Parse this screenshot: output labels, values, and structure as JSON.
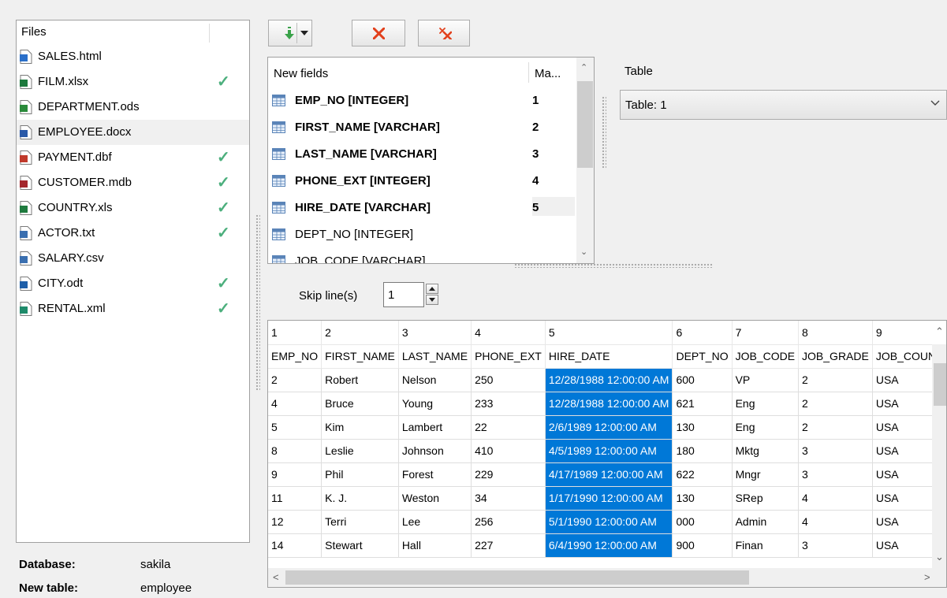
{
  "files": {
    "header": "Files",
    "items": [
      {
        "name": "SALES.html",
        "icon": "html-file-icon",
        "checked": false,
        "selected": false
      },
      {
        "name": "FILM.xlsx",
        "icon": "excel-file-icon",
        "checked": true,
        "selected": false
      },
      {
        "name": "DEPARTMENT.ods",
        "icon": "ods-file-icon",
        "checked": false,
        "selected": false
      },
      {
        "name": "EMPLOYEE.docx",
        "icon": "word-file-icon",
        "checked": false,
        "selected": true
      },
      {
        "name": "PAYMENT.dbf",
        "icon": "dbf-file-icon",
        "checked": true,
        "selected": false
      },
      {
        "name": "CUSTOMER.mdb",
        "icon": "access-file-icon",
        "checked": true,
        "selected": false
      },
      {
        "name": "COUNTRY.xls",
        "icon": "excel-file-icon",
        "checked": true,
        "selected": false
      },
      {
        "name": "ACTOR.txt",
        "icon": "txt-file-icon",
        "checked": true,
        "selected": false
      },
      {
        "name": "SALARY.csv",
        "icon": "csv-file-icon",
        "checked": false,
        "selected": false
      },
      {
        "name": "CITY.odt",
        "icon": "odt-file-icon",
        "checked": true,
        "selected": false
      },
      {
        "name": "RENTAL.xml",
        "icon": "xml-file-icon",
        "checked": true,
        "selected": false
      }
    ],
    "check_glyph": "✓"
  },
  "footer": {
    "database_label": "Database:",
    "database_value": "sakila",
    "new_table_label": "New table:",
    "new_table_value": "employee"
  },
  "toolbar": {
    "buttons": [
      "import-button",
      "import-dropdown",
      "delete-button",
      "clear-button"
    ]
  },
  "fields": {
    "header_name": "New fields",
    "header_map": "Ma...",
    "items": [
      {
        "name": "EMP_NO  [INTEGER]",
        "map": "1",
        "mapped": true,
        "highlight": false
      },
      {
        "name": "FIRST_NAME  [VARCHAR]",
        "map": "2",
        "mapped": true,
        "highlight": false
      },
      {
        "name": "LAST_NAME  [VARCHAR]",
        "map": "3",
        "mapped": true,
        "highlight": false
      },
      {
        "name": "PHONE_EXT  [INTEGER]",
        "map": "4",
        "mapped": true,
        "highlight": false
      },
      {
        "name": "HIRE_DATE  [VARCHAR]",
        "map": "5",
        "mapped": true,
        "highlight": true
      },
      {
        "name": "DEPT_NO  [INTEGER]",
        "map": "",
        "mapped": false,
        "highlight": false
      },
      {
        "name": "JOB_CODE  [VARCHAR]",
        "map": "",
        "mapped": false,
        "highlight": false
      }
    ]
  },
  "table": {
    "label": "Table",
    "value": "Table: 1"
  },
  "skip": {
    "label": "Skip line(s)",
    "value": "1"
  },
  "grid": {
    "selected_column": 4,
    "rows": [
      [
        "1",
        "2",
        "3",
        "4",
        "5",
        "6",
        "7",
        "8",
        "9"
      ],
      [
        "EMP_NO",
        "FIRST_NAME",
        "LAST_NAME",
        "PHONE_EXT",
        "HIRE_DATE",
        "DEPT_NO",
        "JOB_CODE",
        "JOB_GRADE",
        "JOB_COUNTRY"
      ],
      [
        "2",
        "Robert",
        "Nelson",
        "250",
        "12/28/1988 12:00:00 AM",
        "600",
        "VP",
        "2",
        "USA"
      ],
      [
        "4",
        "Bruce",
        "Young",
        "233",
        "12/28/1988 12:00:00 AM",
        "621",
        "Eng",
        "2",
        "USA"
      ],
      [
        "5",
        "Kim",
        "Lambert",
        "22",
        "2/6/1989 12:00:00 AM",
        "130",
        "Eng",
        "2",
        "USA"
      ],
      [
        "8",
        "Leslie",
        "Johnson",
        "410",
        "4/5/1989 12:00:00 AM",
        "180",
        "Mktg",
        "3",
        "USA"
      ],
      [
        "9",
        "Phil",
        "Forest",
        "229",
        "4/17/1989 12:00:00 AM",
        "622",
        "Mngr",
        "3",
        "USA"
      ],
      [
        "11",
        "K. J.",
        "Weston",
        "34",
        "1/17/1990 12:00:00 AM",
        "130",
        "SRep",
        "4",
        "USA"
      ],
      [
        "12",
        "Terri",
        "Lee",
        "256",
        "5/1/1990 12:00:00 AM",
        "000",
        "Admin",
        "4",
        "USA"
      ],
      [
        "14",
        "Stewart",
        "Hall",
        "227",
        "6/4/1990 12:00:00 AM",
        "900",
        "Finan",
        "3",
        "USA"
      ]
    ]
  }
}
